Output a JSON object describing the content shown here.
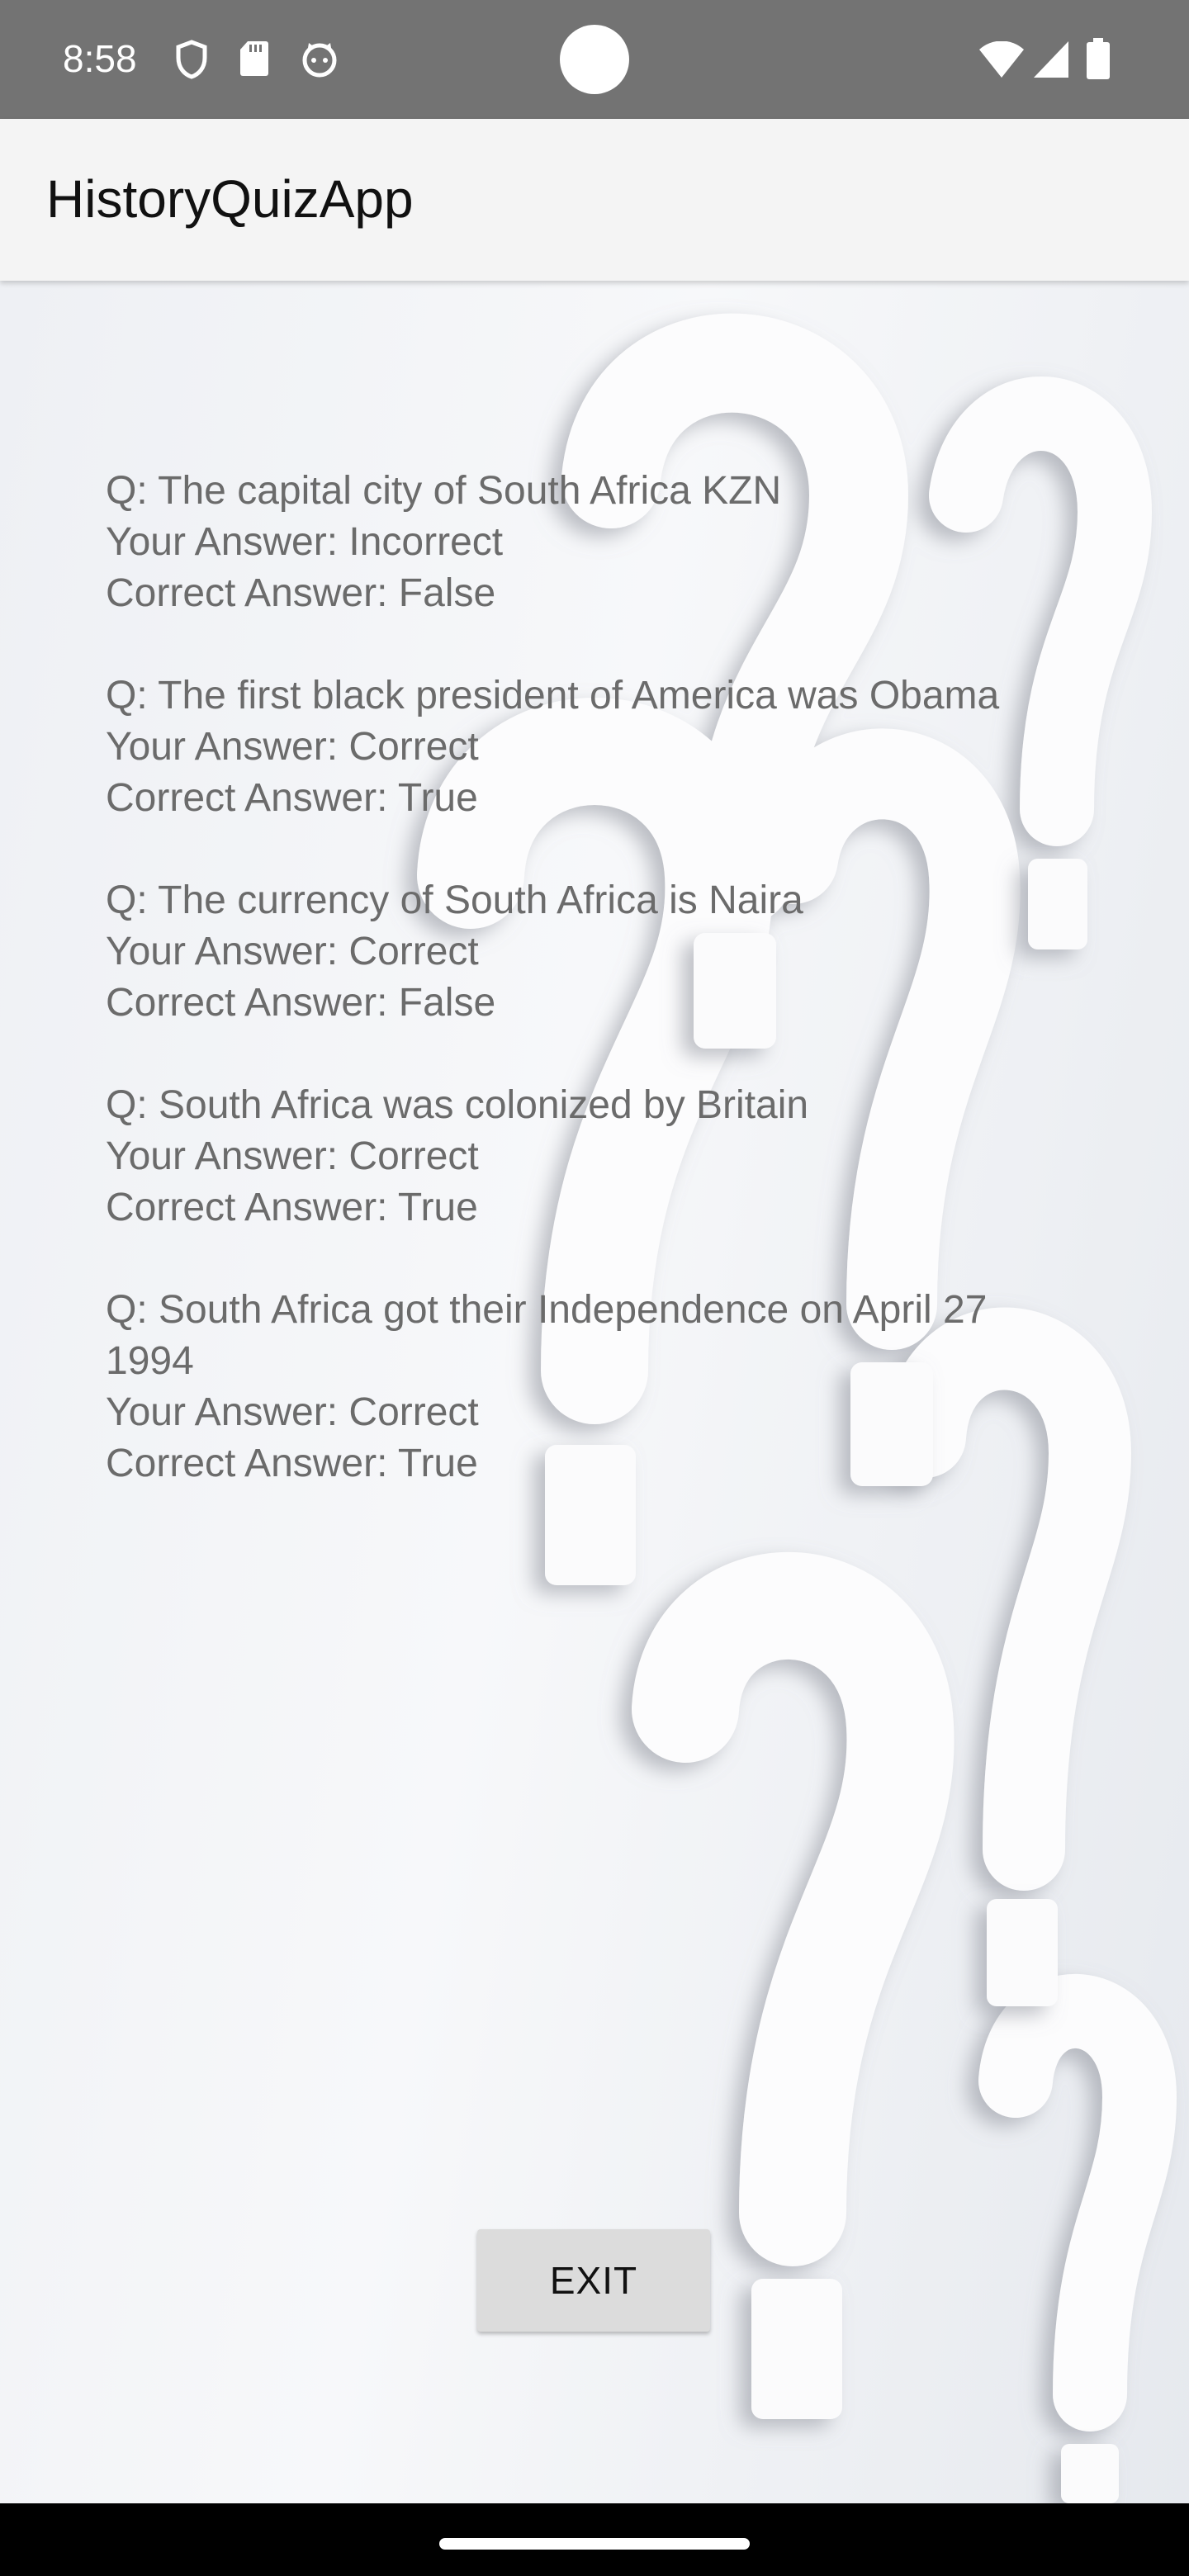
{
  "status_bar": {
    "time": "8:58",
    "left_icons": [
      "shield-icon",
      "sd-card-icon",
      "cat-face-icon"
    ],
    "right_icons": [
      "wifi-icon",
      "signal-icon",
      "battery-icon"
    ]
  },
  "app_bar": {
    "title": "HistoryQuizApp"
  },
  "results": [
    {
      "question": "Q: The capital city of South Africa KZN",
      "your_answer": "Your Answer: Incorrect",
      "correct_answer": "Correct Answer: False"
    },
    {
      "question": "Q: The first black president of America was Obama",
      "your_answer": "Your Answer: Correct",
      "correct_answer": "Correct Answer: True"
    },
    {
      "question": "Q: The currency of South Africa is Naira",
      "your_answer": "Your Answer: Correct",
      "correct_answer": "Correct Answer: False"
    },
    {
      "question": "Q: South Africa was colonized by Britain",
      "your_answer": "Your Answer: Correct",
      "correct_answer": "Correct Answer: True"
    },
    {
      "question": "Q: South Africa got their Independence on April 27 1994",
      "your_answer": "Your Answer: Correct",
      "correct_answer": "Correct Answer: True"
    }
  ],
  "exit_button": {
    "label": "EXIT"
  },
  "colors": {
    "status_bar": "#737373",
    "app_bar": "#f4f4f4",
    "result_text": "#6b6b6b",
    "button": "#dcdcdc"
  }
}
